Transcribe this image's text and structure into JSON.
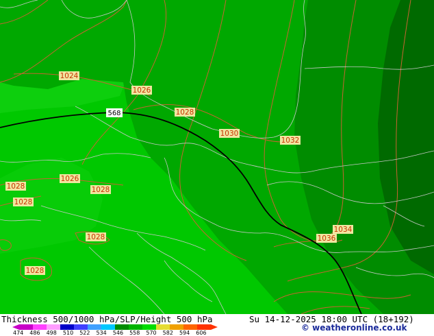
{
  "footer": {
    "title": "Thickness 500/1000 hPa/SLP/Height 500 hPa",
    "valid_time": "Su 14-12-2025 18:00 UTC (18+192)",
    "credit": "© weatheronline.co.uk"
  },
  "legend": {
    "ticks": [
      "474",
      "486",
      "498",
      "510",
      "522",
      "534",
      "546",
      "558",
      "570",
      "582",
      "594",
      "606"
    ],
    "colors": [
      "#c800c8",
      "#ff40ff",
      "#ff9cff",
      "#0000c8",
      "#4040ff",
      "#40a0ff",
      "#00c8ff",
      "#008c00",
      "#00b400",
      "#00dc00",
      "#e6dc32",
      "#f0a000",
      "#ff6400",
      "#ff3200"
    ]
  },
  "map": {
    "contour_label": "568",
    "pressure_labels": [
      "1024",
      "1026",
      "1028",
      "1030",
      "1032",
      "1026",
      "1028",
      "1028",
      "1028",
      "1028",
      "1034",
      "1036",
      "1028"
    ],
    "colors": {
      "light_green": "#00c800",
      "mid_green": "#00a000",
      "dark_green": "#008c00",
      "darkest_green": "#006400",
      "bright_patch": "#14dc14",
      "isobar": "#c86432",
      "border": "#c8c8c8",
      "height_line": "#000000"
    }
  }
}
